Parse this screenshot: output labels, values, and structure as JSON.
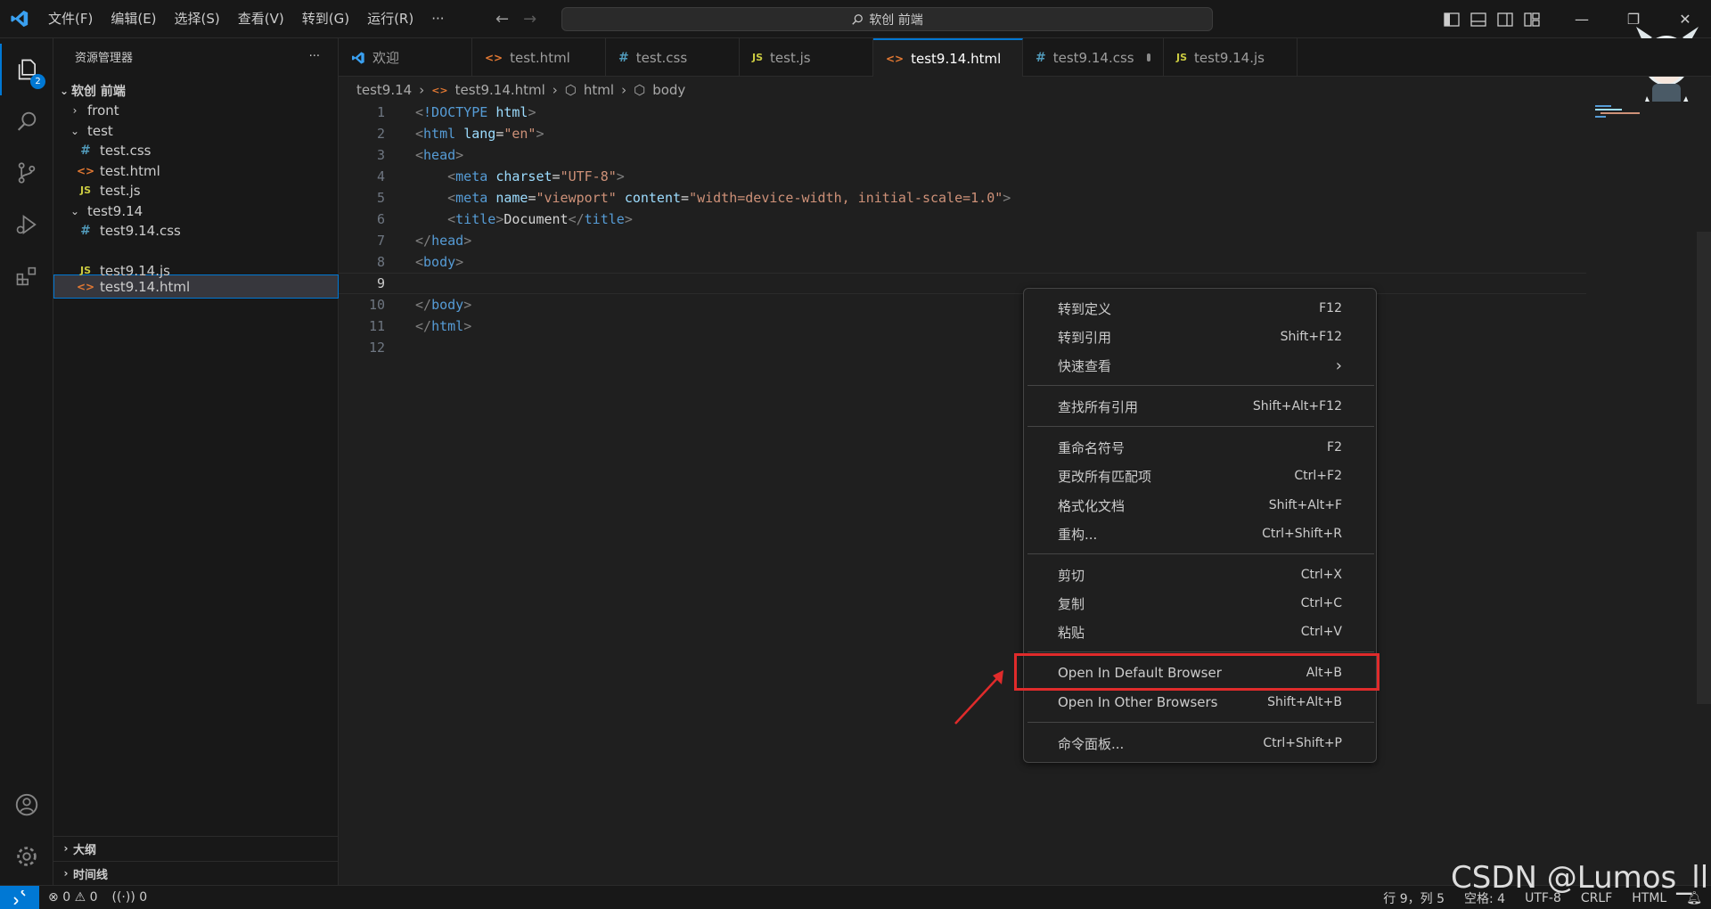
{
  "titlebar": {
    "menu": [
      "文件(F)",
      "编辑(E)",
      "选择(S)",
      "查看(V)",
      "转到(G)",
      "运行(R)",
      "···"
    ],
    "search_text": "软创 前端"
  },
  "activity": {
    "explorer_badge": "2"
  },
  "sidebar": {
    "title": "资源管理器",
    "more": "···",
    "root": "软创 前端",
    "items": [
      {
        "label": "front",
        "type": "folder-collapsed",
        "depth": 1
      },
      {
        "label": "test",
        "type": "folder-open",
        "depth": 1
      },
      {
        "label": "test.css",
        "type": "css",
        "depth": 2
      },
      {
        "label": "test.html",
        "type": "html",
        "depth": 2
      },
      {
        "label": "test.js",
        "type": "js",
        "depth": 2
      },
      {
        "label": "test9.14",
        "type": "folder-open",
        "depth": 1
      },
      {
        "label": "test9.14.css",
        "type": "css",
        "depth": 2
      },
      {
        "label": "test9.14.html",
        "type": "html",
        "depth": 2,
        "selected": true
      },
      {
        "label": "test9.14.js",
        "type": "js",
        "depth": 2
      }
    ],
    "outline": "大纲",
    "timeline": "时间线"
  },
  "tabs": [
    {
      "label": "欢迎",
      "icon": "vscode-icon"
    },
    {
      "label": "test.html",
      "icon": "html-icon"
    },
    {
      "label": "test.css",
      "icon": "css-icon"
    },
    {
      "label": "test.js",
      "icon": "js-icon"
    },
    {
      "label": "test9.14.html",
      "icon": "html-icon",
      "active": true,
      "dirty": true
    },
    {
      "label": "test9.14.css",
      "icon": "css-icon",
      "dirty": true
    },
    {
      "label": "test9.14.js",
      "icon": "js-icon"
    }
  ],
  "breadcrumb": [
    "test9.14",
    "test9.14.html",
    "html",
    "body"
  ],
  "editor": {
    "line_numbers": [
      "1",
      "2",
      "3",
      "4",
      "5",
      "6",
      "7",
      "8",
      "9",
      "10",
      "11",
      "12"
    ],
    "lines": [
      "<!DOCTYPE html>",
      "<html lang=\"en\">",
      "<head>",
      "    <meta charset=\"UTF-8\">",
      "    <meta name=\"viewport\" content=\"width=device-width, initial-scale=1.0\">",
      "    <title>Document</title>",
      "</head>",
      "<body>",
      "",
      "</body>",
      "</html>",
      ""
    ],
    "current_line": 9
  },
  "context_menu": {
    "items": [
      {
        "label": "转到定义",
        "key": "F12"
      },
      {
        "label": "转到引用",
        "key": "Shift+F12"
      },
      {
        "label": "快速查看",
        "key": "›"
      },
      {
        "label": "查找所有引用",
        "key": "Shift+Alt+F12"
      },
      {
        "label": "重命名符号",
        "key": "F2"
      },
      {
        "label": "更改所有匹配项",
        "key": "Ctrl+F2"
      },
      {
        "label": "格式化文档",
        "key": "Shift+Alt+F"
      },
      {
        "label": "重构...",
        "key": "Ctrl+Shift+R"
      },
      {
        "label": "剪切",
        "key": "Ctrl+X"
      },
      {
        "label": "复制",
        "key": "Ctrl+C"
      },
      {
        "label": "粘贴",
        "key": "Ctrl+V"
      },
      {
        "label": "Open In Default Browser",
        "key": "Alt+B"
      },
      {
        "label": "Open In Other Browsers",
        "key": "Shift+Alt+B"
      },
      {
        "label": "命令面板...",
        "key": "Ctrl+Shift+P"
      }
    ]
  },
  "statusbar": {
    "errors": "0",
    "warnings": "0",
    "ports": "0",
    "position": "行 9，列 5",
    "spaces": "空格: 4",
    "encoding": "UTF-8",
    "eol": "CRLF",
    "language": "HTML"
  },
  "watermark": "CSDN @Lumos_ll",
  "colors": {
    "accent": "#0078d4",
    "highlight_box": "#e02b2b"
  }
}
